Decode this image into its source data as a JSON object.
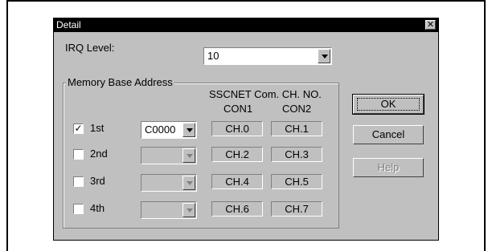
{
  "dialog": {
    "title": "Detail",
    "close_glyph": "✕"
  },
  "irq": {
    "label": "IRQ Level:",
    "value": "10"
  },
  "memory": {
    "group_label": "Memory Base Address",
    "header_line1": "SSCNET Com. CH. NO.",
    "col1": "CON1",
    "col2": "CON2",
    "rows": [
      {
        "label": "1st",
        "checked": true,
        "address": "C0000",
        "enabled": true,
        "con1": "CH.0",
        "con2": "CH.1"
      },
      {
        "label": "2nd",
        "checked": false,
        "address": "",
        "enabled": false,
        "con1": "CH.2",
        "con2": "CH.3"
      },
      {
        "label": "3rd",
        "checked": false,
        "address": "",
        "enabled": false,
        "con1": "CH.4",
        "con2": "CH.5"
      },
      {
        "label": "4th",
        "checked": false,
        "address": "",
        "enabled": false,
        "con1": "CH.6",
        "con2": "CH.7"
      }
    ]
  },
  "buttons": {
    "ok": "OK",
    "cancel": "Cancel",
    "help": "Help"
  },
  "icons": {
    "checkmark": "✓"
  }
}
